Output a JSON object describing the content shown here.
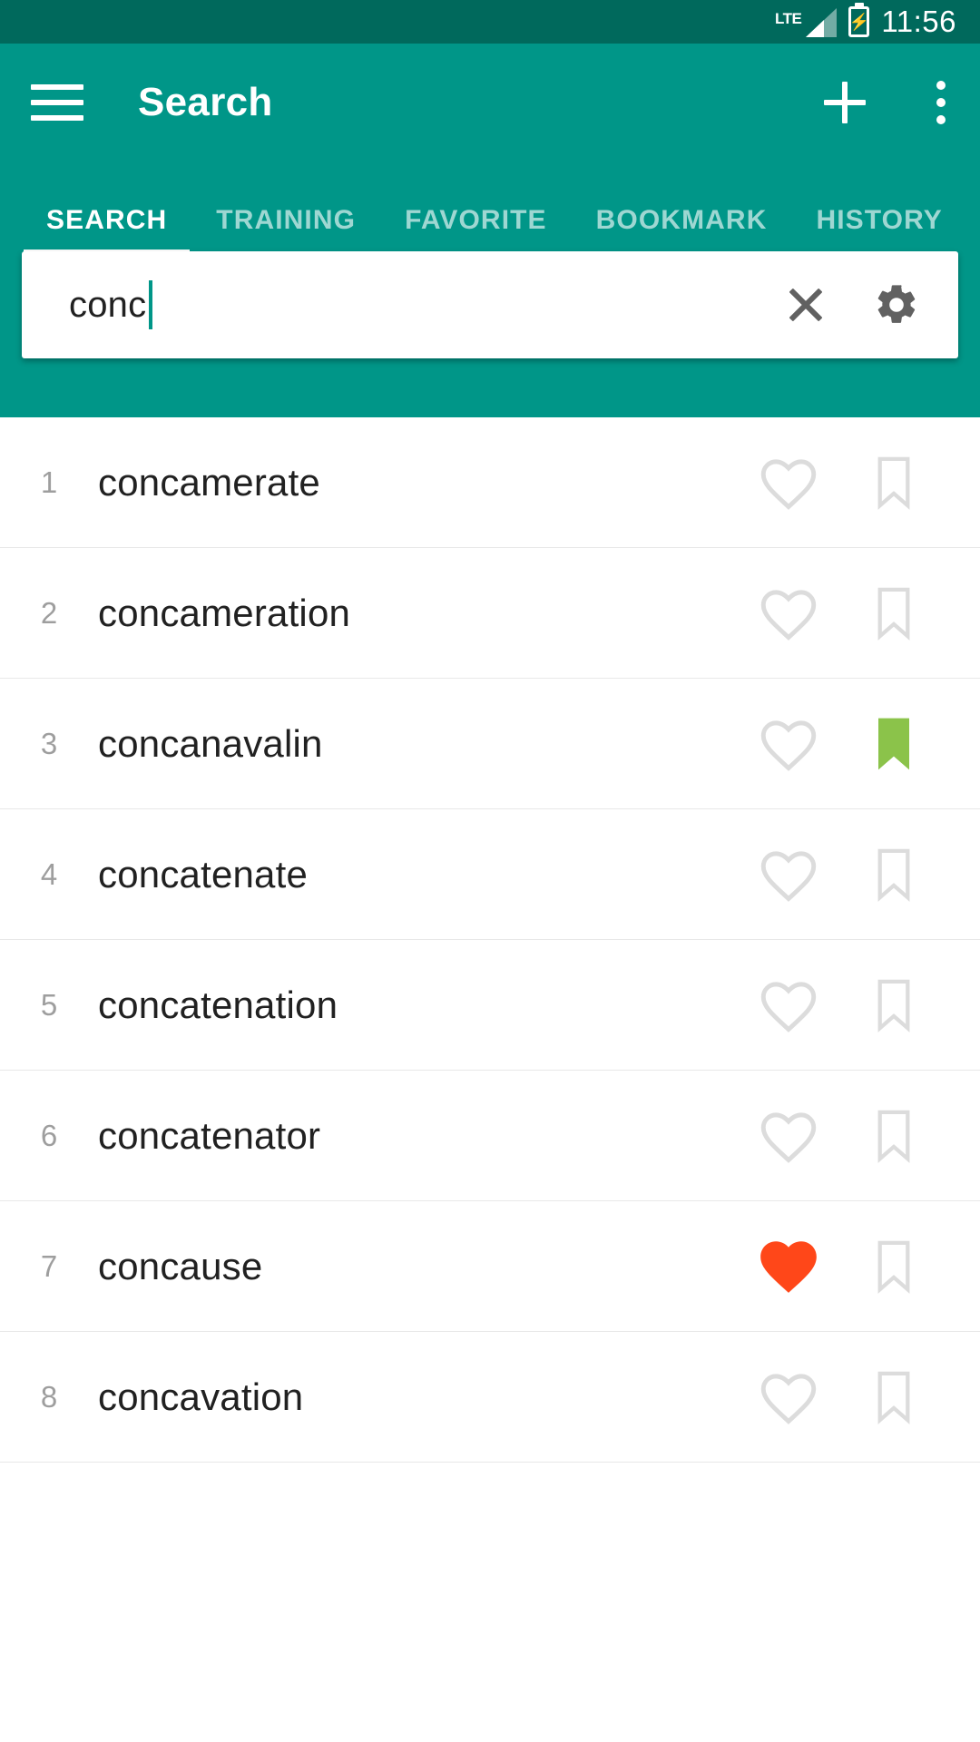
{
  "status_bar": {
    "network_label": "LTE",
    "signal_icon": "signal-bars-icon",
    "battery_icon": "battery-charging-icon",
    "time": "11:56",
    "background_color": "#00695c"
  },
  "app_bar": {
    "menu_icon": "hamburger-menu-icon",
    "title": "Search",
    "add_icon": "plus-icon",
    "overflow_icon": "kebab-menu-icon",
    "background_color": "#009688"
  },
  "tabs": {
    "active_index": 0,
    "items": [
      {
        "label": "SEARCH"
      },
      {
        "label": "TRAINING"
      },
      {
        "label": "FAVORITE"
      },
      {
        "label": "BOOKMARK"
      },
      {
        "label": "HISTORY"
      }
    ]
  },
  "search": {
    "value": "conc",
    "placeholder": "Search",
    "clear_icon": "close-x-icon",
    "settings_icon": "gear-icon",
    "caret_color": "#009688"
  },
  "colors": {
    "accent": "#009688",
    "status_bar": "#00695c",
    "favorite_active": "#ff4719",
    "bookmark_active": "#8bc34a",
    "icon_inactive": "#dcdcdc"
  },
  "results": [
    {
      "index": "1",
      "word": "concamerate",
      "favorite": false,
      "bookmark": false
    },
    {
      "index": "2",
      "word": "concameration",
      "favorite": false,
      "bookmark": false
    },
    {
      "index": "3",
      "word": "concanavalin",
      "favorite": false,
      "bookmark": true
    },
    {
      "index": "4",
      "word": "concatenate",
      "favorite": false,
      "bookmark": false
    },
    {
      "index": "5",
      "word": "concatenation",
      "favorite": false,
      "bookmark": false
    },
    {
      "index": "6",
      "word": "concatenator",
      "favorite": false,
      "bookmark": false
    },
    {
      "index": "7",
      "word": "concause",
      "favorite": true,
      "bookmark": false
    },
    {
      "index": "8",
      "word": "concavation",
      "favorite": false,
      "bookmark": false
    }
  ]
}
